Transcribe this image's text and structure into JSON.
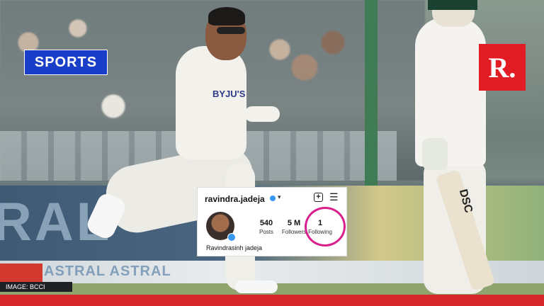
{
  "badges": {
    "category": "SPORTS",
    "brand_logo": "R."
  },
  "credit": "IMAGE: BCCI",
  "instagram": {
    "handle": "ravindra.jadeja",
    "verified_icon": "verified-badge-icon",
    "name": "Ravindrasinh jadeja",
    "stats": [
      {
        "value": "540",
        "label": "Posts"
      },
      {
        "value": "5 M",
        "label": "Followers"
      },
      {
        "value": "1",
        "label": "Following"
      }
    ]
  },
  "background_text": {
    "board": "RAL",
    "ad": "ASTRAL ASTRAL",
    "jersey": "BYJU'S",
    "bat": "DSC"
  },
  "colors": {
    "sports_badge": "#1b3ec8",
    "brand_red": "#e21c23",
    "highlight_circle": "#d81f8c",
    "bottom_bar": "#d7262c"
  }
}
